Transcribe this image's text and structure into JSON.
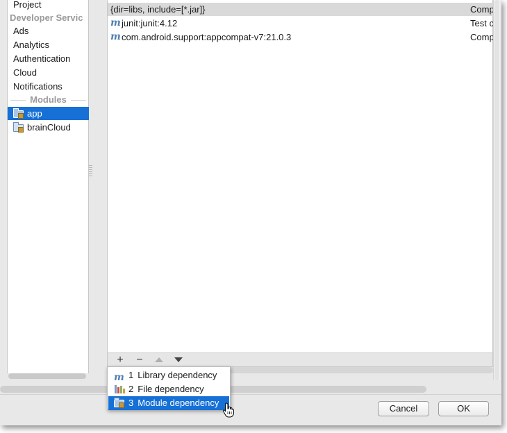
{
  "sidebar": {
    "items_top": [
      {
        "label": "Project"
      }
    ],
    "developer_services_header": "Developer Servic",
    "services": [
      {
        "label": "Ads"
      },
      {
        "label": "Analytics"
      },
      {
        "label": "Authentication"
      },
      {
        "label": "Cloud"
      },
      {
        "label": "Notifications"
      }
    ],
    "modules_header": "Modules",
    "modules": [
      {
        "label": "app",
        "selected": true
      },
      {
        "label": "brainCloud",
        "selected": false
      }
    ]
  },
  "dependencies": {
    "rows": [
      {
        "name": "{dir=libs, include=[*.jar]}",
        "scope": "Comp",
        "icon": "none"
      },
      {
        "name": "junit:junit:4.12",
        "scope": "Test c",
        "icon": "maven-m-icon"
      },
      {
        "name": "com.android.support:appcompat-v7:21.0.3",
        "scope": "Comp",
        "icon": "maven-m-icon"
      }
    ]
  },
  "toolbar": {
    "add": "+",
    "remove": "−"
  },
  "add_menu": {
    "items": [
      {
        "number": "1",
        "label": "Library dependency",
        "icon": "maven-m-icon"
      },
      {
        "number": "2",
        "label": "File dependency",
        "icon": "file-bars-icon"
      },
      {
        "number": "3",
        "label": "Module dependency",
        "icon": "module-folder-icon",
        "highlighted": true
      }
    ]
  },
  "buttons": {
    "cancel": "Cancel",
    "ok": "OK"
  },
  "colors": {
    "selection": "#1670d6",
    "maven_icon": "#4e7fb0"
  }
}
